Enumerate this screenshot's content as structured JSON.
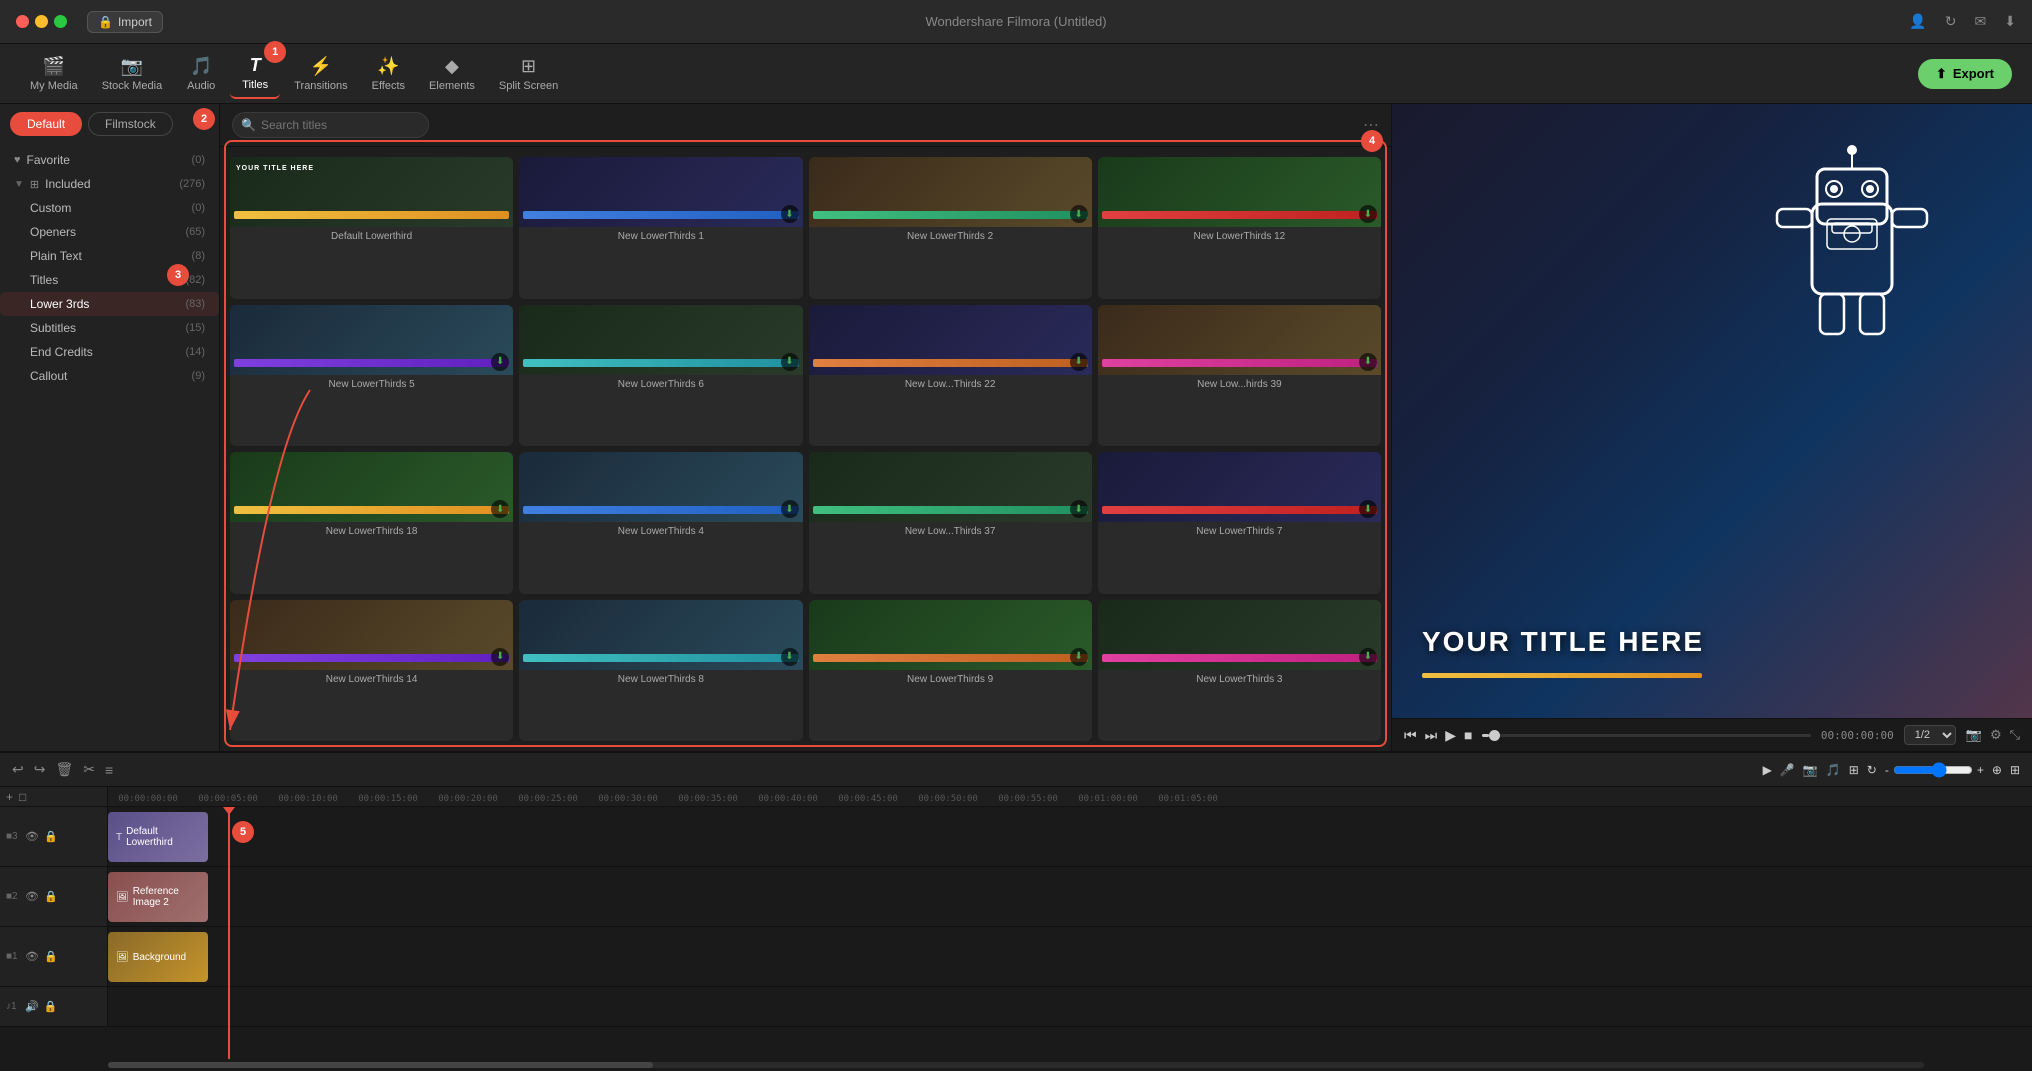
{
  "app": {
    "title": "Wondershare Filmora (Untitled)"
  },
  "titlebar": {
    "import_label": "Import"
  },
  "toolbar": {
    "items": [
      {
        "id": "my-media",
        "label": "My Media",
        "icon": "🎬"
      },
      {
        "id": "stock-media",
        "label": "Stock Media",
        "icon": "📷"
      },
      {
        "id": "audio",
        "label": "Audio",
        "icon": "🎵"
      },
      {
        "id": "titles",
        "label": "Titles",
        "icon": "T",
        "active": true
      },
      {
        "id": "transitions",
        "label": "Transitions",
        "icon": "⚡"
      },
      {
        "id": "effects",
        "label": "Effects",
        "icon": "✨"
      },
      {
        "id": "elements",
        "label": "Elements",
        "icon": "◆"
      },
      {
        "id": "split-screen",
        "label": "Split Screen",
        "icon": "⊞"
      }
    ],
    "export_label": "Export"
  },
  "panel": {
    "tabs": [
      {
        "id": "default",
        "label": "Default",
        "active": true
      },
      {
        "id": "filmstock",
        "label": "Filmstock"
      }
    ],
    "sidebar": [
      {
        "id": "favorite",
        "label": "Favorite",
        "count": "0",
        "icon": "heart",
        "indent": false
      },
      {
        "id": "included",
        "label": "Included",
        "count": "276",
        "icon": "folder",
        "indent": false,
        "expandable": true
      },
      {
        "id": "custom",
        "label": "Custom",
        "count": "0",
        "icon": "",
        "indent": true
      },
      {
        "id": "openers",
        "label": "Openers",
        "count": "65",
        "icon": "",
        "indent": true
      },
      {
        "id": "plain-text",
        "label": "Plain Text",
        "count": "8",
        "icon": "",
        "indent": true
      },
      {
        "id": "titles",
        "label": "Titles",
        "count": "82",
        "icon": "",
        "indent": true
      },
      {
        "id": "lower-3rds",
        "label": "Lower 3rds",
        "count": "83",
        "icon": "",
        "indent": true,
        "active": true
      },
      {
        "id": "subtitles",
        "label": "Subtitles",
        "count": "15",
        "icon": "",
        "indent": true
      },
      {
        "id": "end-credits",
        "label": "End Credits",
        "count": "14",
        "icon": "",
        "indent": true
      },
      {
        "id": "callout",
        "label": "Callout",
        "count": "9",
        "icon": "",
        "indent": true
      }
    ]
  },
  "search": {
    "placeholder": "Search titles"
  },
  "titles_grid": [
    {
      "id": 1,
      "name": "Default Lowerthird",
      "thumb_type": "dark",
      "bar": "yellow",
      "has_download": false,
      "title_text": "YOUR TITLE HERE"
    },
    {
      "id": 2,
      "name": "New LowerThirds 1",
      "thumb_type": "blue",
      "bar": "blue",
      "has_download": true
    },
    {
      "id": 3,
      "name": "New LowerThirds 2",
      "thumb_type": "brown",
      "bar": "green",
      "has_download": true
    },
    {
      "id": 4,
      "name": "New LowerThirds 12",
      "thumb_type": "forest",
      "bar": "red",
      "has_download": true
    },
    {
      "id": 5,
      "name": "New LowerThirds 5",
      "thumb_type": "sky",
      "bar": "purple",
      "has_download": true
    },
    {
      "id": 6,
      "name": "New LowerThirds 6",
      "thumb_type": "dark",
      "bar": "teal",
      "has_download": true
    },
    {
      "id": 7,
      "name": "New Low...Thirds 22",
      "thumb_type": "blue",
      "bar": "orange",
      "has_download": true
    },
    {
      "id": 8,
      "name": "New Low...hirds 39",
      "thumb_type": "brown",
      "bar": "pink",
      "has_download": true
    },
    {
      "id": 9,
      "name": "New LowerThirds 18",
      "thumb_type": "forest",
      "bar": "yellow",
      "has_download": true
    },
    {
      "id": 10,
      "name": "New LowerThirds 4",
      "thumb_type": "sky",
      "bar": "blue",
      "has_download": true
    },
    {
      "id": 11,
      "name": "New Low...Thirds 37",
      "thumb_type": "dark",
      "bar": "green",
      "has_download": true
    },
    {
      "id": 12,
      "name": "New LowerThirds 7",
      "thumb_type": "blue",
      "bar": "red",
      "has_download": true
    },
    {
      "id": 13,
      "name": "New LowerThirds 14",
      "thumb_type": "brown",
      "bar": "purple",
      "has_download": true
    },
    {
      "id": 14,
      "name": "New LowerThirds 8",
      "thumb_type": "sky",
      "bar": "teal",
      "has_download": true
    },
    {
      "id": 15,
      "name": "New LowerThirds 9",
      "thumb_type": "forest",
      "bar": "orange",
      "has_download": true
    },
    {
      "id": 16,
      "name": "New LowerThirds 3",
      "thumb_type": "dark",
      "bar": "pink",
      "has_download": true
    }
  ],
  "preview": {
    "title_text": "YOUR TITLE HERE",
    "time_current": "00:00:00:00",
    "time_total": "00:00:00:00",
    "scale": "1/2"
  },
  "timeline": {
    "ruler_marks": [
      "00:00:00:00",
      "00:00:05:00",
      "00:00:10:00",
      "00:00:15:00",
      "00:00:20:00",
      "00:00:25:00",
      "00:00:30:00",
      "00:00:35:00",
      "00:00:40:00",
      "00:00:45:00",
      "00:00:50:00",
      "00:00:55:00",
      "00:01:00:00",
      "00:01:05:00"
    ],
    "tracks": [
      {
        "num": "3",
        "clip": "Default Lowerthird",
        "type": "title",
        "color": "title"
      },
      {
        "num": "2",
        "clip": "Reference Image 2",
        "type": "ref",
        "color": "ref"
      },
      {
        "num": "1",
        "clip": "Background",
        "type": "bg",
        "color": "bg"
      },
      {
        "num": "1",
        "clip": "",
        "type": "audio",
        "color": "audio"
      }
    ]
  },
  "annotations": {
    "badge1": "1",
    "badge2": "2",
    "badge3": "3",
    "badge4": "4",
    "badge5": "5"
  }
}
